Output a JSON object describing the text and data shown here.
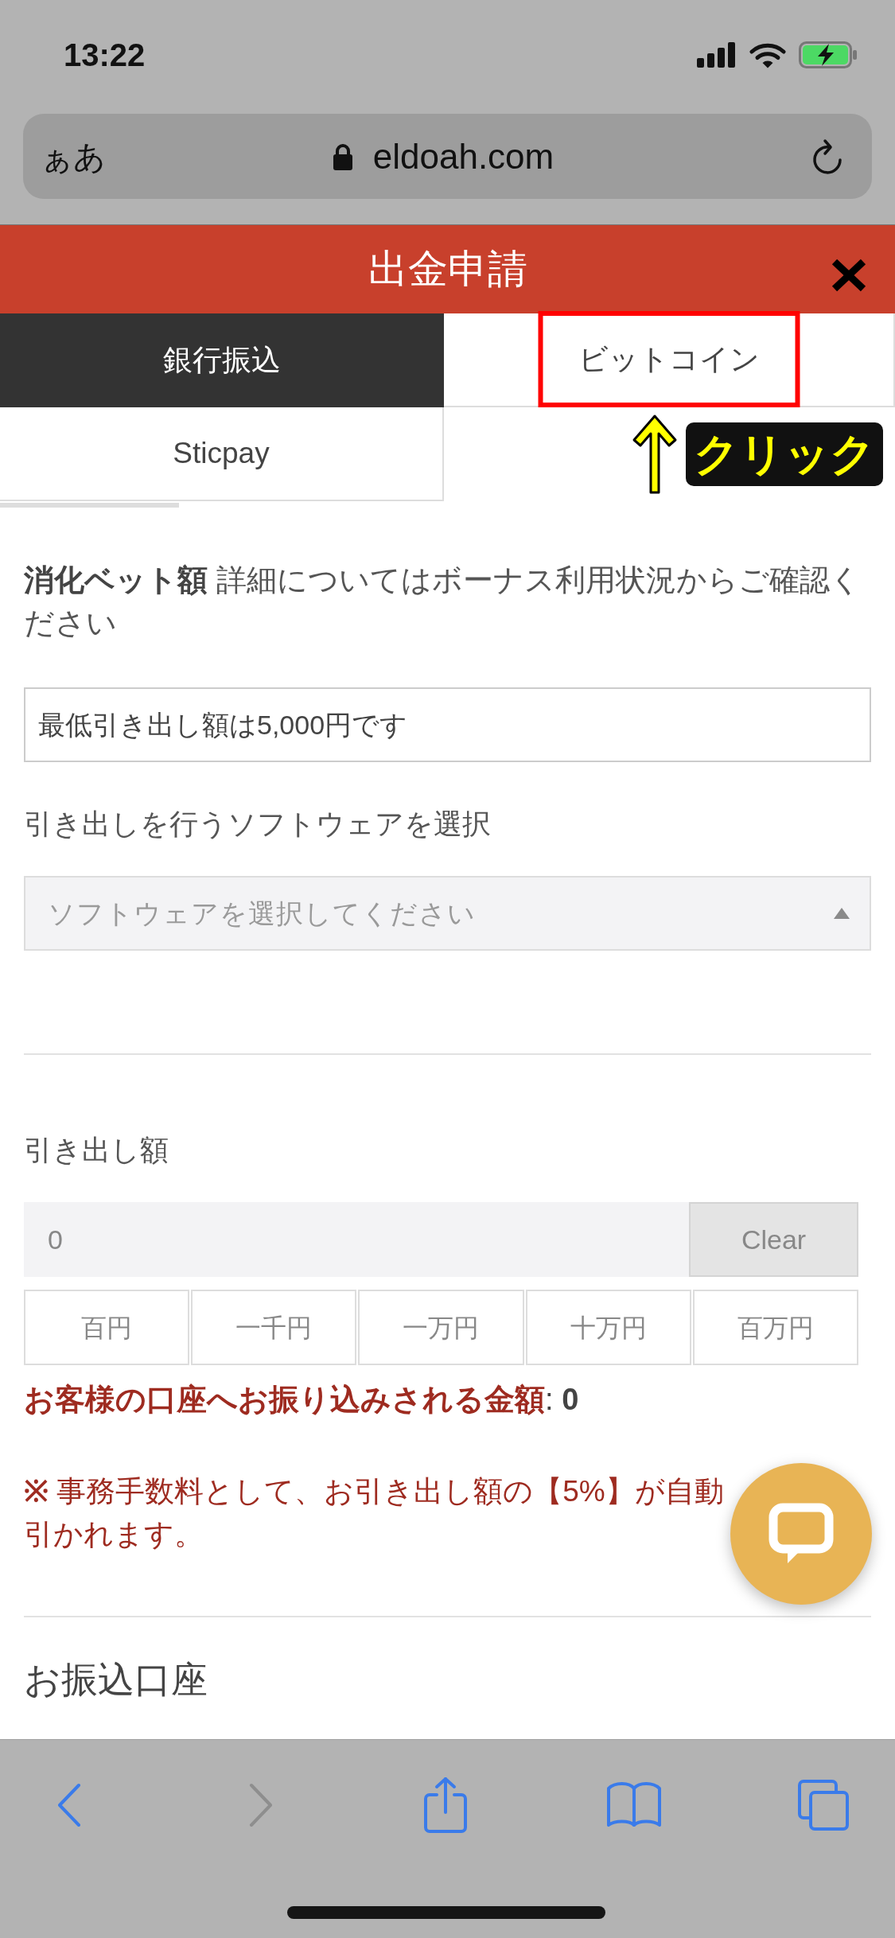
{
  "status_bar": {
    "time": "13:22"
  },
  "address_bar": {
    "text_size_button": "ぁあ",
    "domain": "eldoah.com"
  },
  "header": {
    "title": "出金申請"
  },
  "tabs": [
    {
      "label": "銀行振込",
      "selected": true,
      "annotated": false
    },
    {
      "label": "ビットコイン",
      "selected": false,
      "annotated": true
    },
    {
      "label": "Sticpay",
      "selected": false,
      "annotated": false
    }
  ],
  "annotation": {
    "label": "クリック"
  },
  "intro": "**消化ベット額** 詳細についてはボーナス利用状況からご確認ください",
  "notice": "最低引き出し額は5,000円です",
  "software": {
    "label": "引き出しを行うソフトウェアを選択",
    "placeholder": "ソフトウェアを選択してください"
  },
  "amount": {
    "label": "引き出し額",
    "value": "0",
    "clear_button": "Clear",
    "quick_buttons": [
      "百円",
      "一千円",
      "一万円",
      "十万円",
      "百万円"
    ]
  },
  "transfer_total": "**お客様の口座へお振り込みされる金額**: **0**",
  "fee_note": [
    "**※** 事務手数料として、お引き出し額の【5%】が自動",
    "引かれます。"
  ],
  "account_section": {
    "title": "お振込口座"
  },
  "browser_toolbar": {
    "back_disabled": false,
    "forward_disabled": true
  }
}
